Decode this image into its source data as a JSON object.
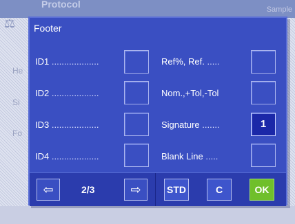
{
  "background": {
    "title": "Protocol",
    "rows": [
      "He",
      "Si",
      "Fo"
    ],
    "top_right": "Sample"
  },
  "dialog": {
    "title": "Footer",
    "left_items": [
      {
        "label": "ID1",
        "dots": "...................",
        "value": ""
      },
      {
        "label": "ID2",
        "dots": "...................",
        "value": ""
      },
      {
        "label": "ID3",
        "dots": "...................",
        "value": ""
      },
      {
        "label": "ID4",
        "dots": "...................",
        "value": ""
      }
    ],
    "right_items": [
      {
        "label": "Ref%, Ref.",
        "dots": ".....",
        "value": ""
      },
      {
        "label": "Nom.,+Tol,-Tol",
        "dots": "",
        "value": ""
      },
      {
        "label": "Signature",
        "dots": ".......",
        "value": "1"
      },
      {
        "label": "Blank Line",
        "dots": ".....",
        "value": ""
      }
    ]
  },
  "footer": {
    "prev_icon": "arrow-left-icon",
    "next_icon": "arrow-right-icon",
    "page": "2/3",
    "std_label": "STD",
    "c_label": "C",
    "ok_label": "OK"
  },
  "colors": {
    "dialog_bg": "#3a4fc2",
    "active_cell": "#1b28a8",
    "ok_green": "#6fbf2b"
  }
}
